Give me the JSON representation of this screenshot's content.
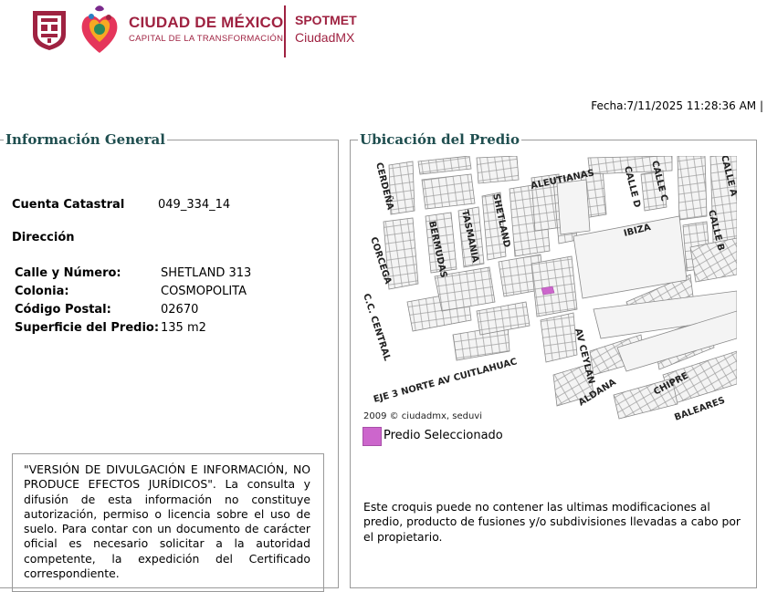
{
  "header": {
    "brand_main": "CIUDAD DE MÉXICO",
    "brand_sub": "CAPITAL DE LA TRANSFORMACIÓN",
    "app_line1": "SPOTMET",
    "app_line2": "CiudadMX",
    "colors": {
      "brand": "#9f2241"
    }
  },
  "fecha": "Fecha:7/11/2025 11:28:36 AM |",
  "info": {
    "legend": "Información General",
    "cuenta_label": "Cuenta Catastral",
    "cuenta_value": "049_334_14",
    "direccion_label": "Dirección",
    "rows": [
      {
        "label": "Calle y Número:",
        "value": "SHETLAND 313"
      },
      {
        "label": "Colonia:",
        "value": "COSMOPOLITA"
      },
      {
        "label": "Código Postal:",
        "value": "02670"
      },
      {
        "label": "Superficie del Predio:",
        "value": "135 m2"
      }
    ],
    "disclaimer": "\"VERSIÓN DE DIVULGACIÓN E INFORMACIÓN, NO PRODUCE EFECTOS JURÍDICOS\". La consulta y difusión de esta información no constituye autorización, permiso o licencia sobre el uso de suelo. Para contar con un documento de carácter oficial es necesario solicitar a la autoridad competente, la expedición del Certificado correspondiente."
  },
  "ubicacion": {
    "legend": "Ubicación del Predio",
    "streets": {
      "cerdena": "CERDEÑA",
      "aleutianas": "ALEUTIANAS",
      "calle_d": "CALLE D",
      "calle_c": "CALLE C",
      "calle_a": "CALLE A",
      "shetland": "SHETLAND",
      "bermudas": "BERMUDAS",
      "tasmania": "TASMANIA",
      "ibiza": "IBIZA",
      "calle_b": "CALLE B",
      "corcega": "CORCEGA",
      "central": "C.C. CENTRAL",
      "ceylan": "AV CEYLAN",
      "aldana": "ALDANA",
      "chipre": "CHIPRE",
      "baleares": "BALEARES",
      "cuitlahuac": "EJE 3 NORTE AV CUITLAHUAC"
    },
    "copyright": "2009 © ciudadmx, seduvi",
    "legend_item": "Predio Seleccionado",
    "predio_color": "#cc66cc",
    "note": "Este croquis puede no contener las ultimas modificaciones al predio, producto de fusiones y/o subdivisiones llevadas a cabo por el propietario."
  }
}
